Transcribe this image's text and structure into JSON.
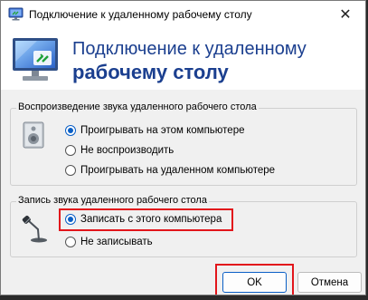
{
  "window": {
    "title": "Подключение к удаленному рабочему столу",
    "close_glyph": "✕"
  },
  "banner": {
    "line1": "Подключение к удаленному",
    "line2": "рабочему столу"
  },
  "playback": {
    "legend": "Воспроизведение звука удаленного рабочего стола",
    "options": [
      {
        "label": "Проигрывать на этом компьютере",
        "checked": true
      },
      {
        "label": "Не воспроизводить",
        "checked": false
      },
      {
        "label": "Проигрывать на удаленном компьютере",
        "checked": false
      }
    ]
  },
  "recording": {
    "legend": "Запись звука удаленного рабочего стола",
    "options": [
      {
        "label": "Записать с этого компьютера",
        "checked": true
      },
      {
        "label": "Не записывать",
        "checked": false
      }
    ]
  },
  "buttons": {
    "ok": "OK",
    "cancel": "Отмена"
  },
  "colors": {
    "accent": "#0a5fc6",
    "banner_text": "#1b3f8f",
    "highlight": "#e2151b"
  },
  "icons": {
    "app": "remote-desktop-icon",
    "banner": "remote-desktop-large-icon",
    "speaker": "speaker-icon",
    "microphone": "microphone-icon"
  }
}
